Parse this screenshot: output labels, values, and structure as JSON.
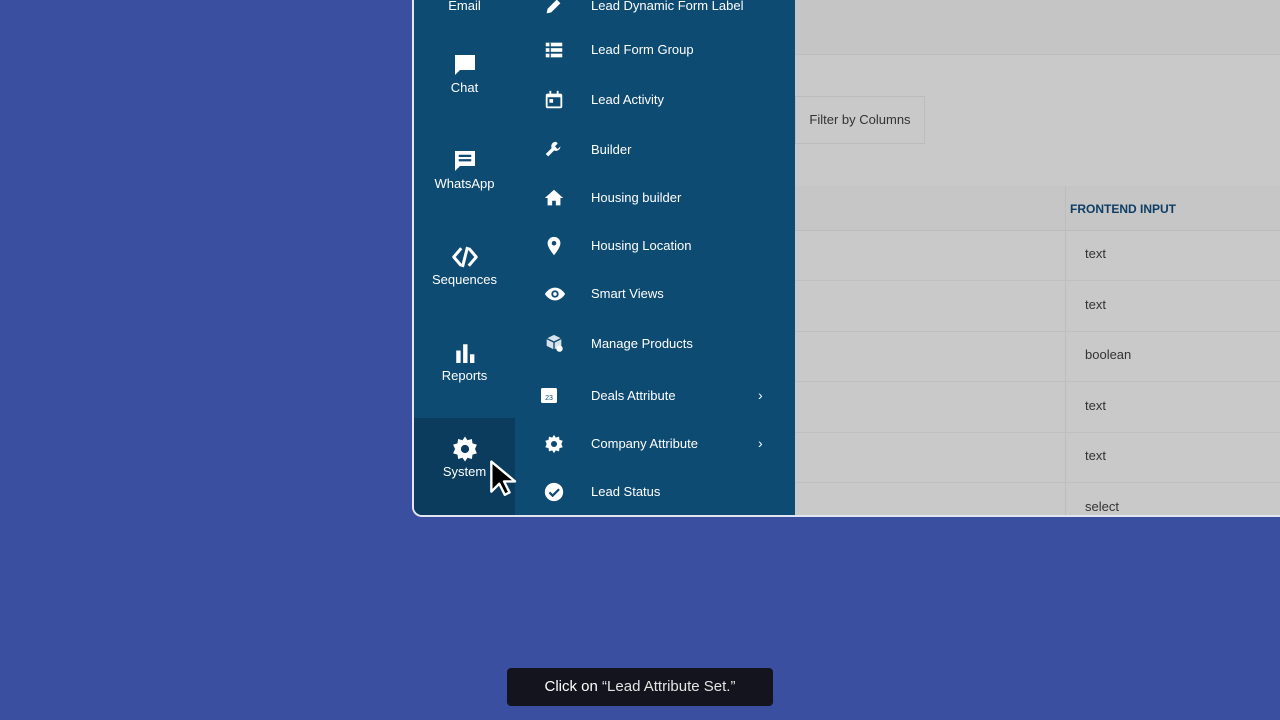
{
  "rail": {
    "items": [
      {
        "label": "Email",
        "icon": "email-icon"
      },
      {
        "label": "Chat",
        "icon": "chat-icon"
      },
      {
        "label": "WhatsApp",
        "icon": "whatsapp-icon"
      },
      {
        "label": "Sequences",
        "icon": "sequences-icon"
      },
      {
        "label": "Reports",
        "icon": "reports-icon"
      },
      {
        "label": "System",
        "icon": "gear-icon"
      }
    ]
  },
  "submenu": {
    "items": [
      {
        "label": "Lead Dynamic Form Label",
        "icon": "pencil-icon"
      },
      {
        "label": "Lead Form Group",
        "icon": "list-icon"
      },
      {
        "label": "Lead Activity",
        "icon": "calendar-icon"
      },
      {
        "label": "Builder",
        "icon": "wrench-icon"
      },
      {
        "label": "Housing builder",
        "icon": "home-icon"
      },
      {
        "label": "Housing Location",
        "icon": "map-pin-icon"
      },
      {
        "label": "Smart Views",
        "icon": "eye-icon"
      },
      {
        "label": "Manage Products",
        "icon": "products-icon"
      },
      {
        "label": "Deals Attribute",
        "icon": "calendar-day-icon",
        "day": "23",
        "has_submenu": true
      },
      {
        "label": "Company Attribute",
        "icon": "gear-icon",
        "has_submenu": true
      },
      {
        "label": "Lead Status",
        "icon": "check-circle-icon"
      }
    ]
  },
  "content": {
    "filter_button": "Filter by Columns",
    "column_header": "FRONTEND INPUT",
    "rows": [
      "text",
      "text",
      "boolean",
      "text",
      "text",
      "select"
    ]
  },
  "tooltip": {
    "action": "Click on",
    "target": "“Lead Attribute Set.”"
  },
  "colors": {
    "background": "#3a4fa0",
    "sidebar": "#0e4b72",
    "tooltip": "#14141e",
    "header_text": "#0e3d66"
  }
}
